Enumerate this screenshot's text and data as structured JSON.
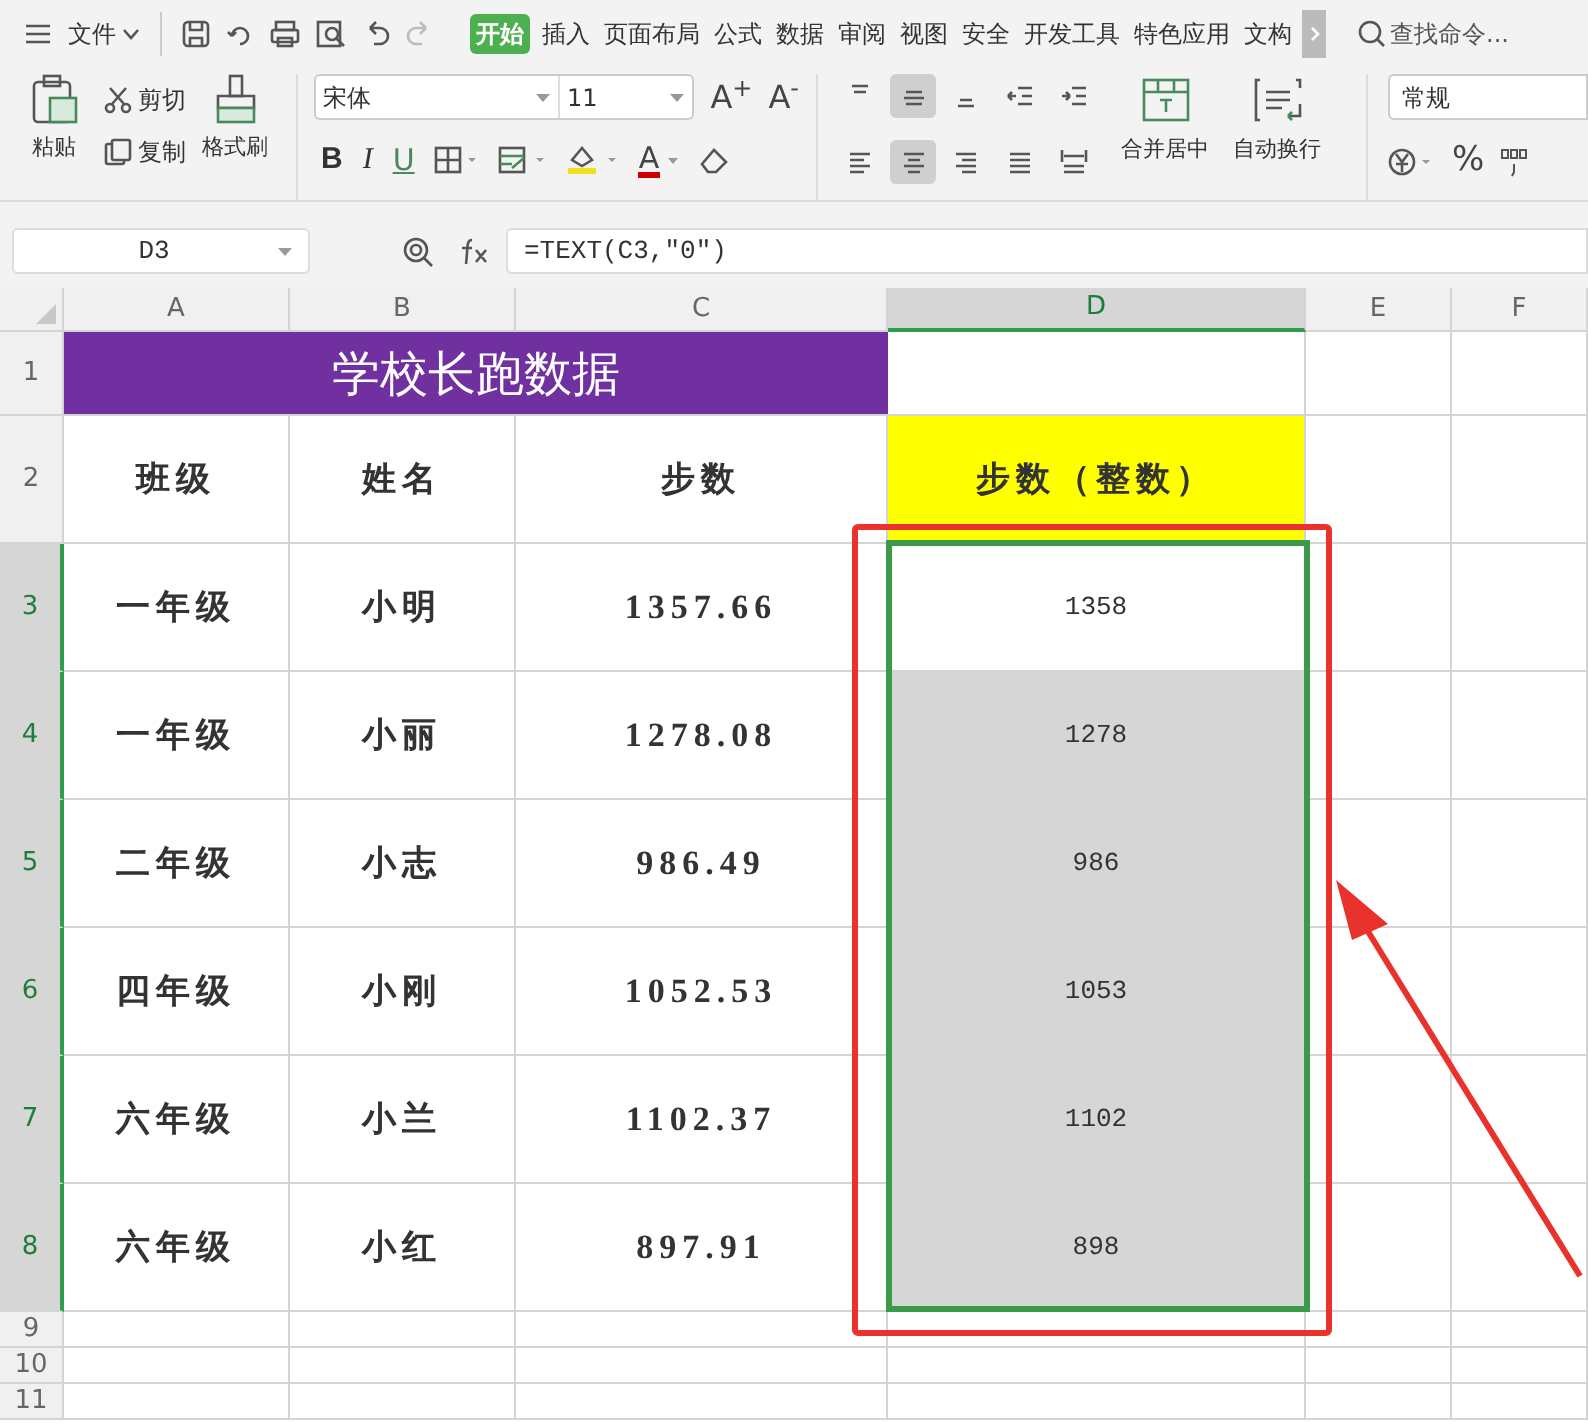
{
  "menu": {
    "file_label": "文件"
  },
  "tabs": [
    {
      "label": "开始",
      "selected": true
    },
    {
      "label": "插入",
      "selected": false
    },
    {
      "label": "页面布局",
      "selected": false
    },
    {
      "label": "公式",
      "selected": false
    },
    {
      "label": "数据",
      "selected": false
    },
    {
      "label": "审阅",
      "selected": false
    },
    {
      "label": "视图",
      "selected": false
    },
    {
      "label": "安全",
      "selected": false
    },
    {
      "label": "开发工具",
      "selected": false
    },
    {
      "label": "特色应用",
      "selected": false
    },
    {
      "label": "文构",
      "selected": false
    }
  ],
  "search": {
    "placeholder": "查找命令..."
  },
  "clipboard": {
    "paste": "粘贴",
    "cut": "剪切",
    "copy": "复制",
    "format_painter": "格式刷"
  },
  "font": {
    "name": "宋体",
    "size": "11",
    "grow": "A$^{+}$",
    "shrink": "A$^{-}$",
    "bold": "B",
    "italic": "I",
    "underline": "U",
    "font_color": "A"
  },
  "alignment": {
    "buttons": [
      {
        "kind": "top",
        "selected": false
      },
      {
        "kind": "middle",
        "selected": true
      },
      {
        "kind": "bottom",
        "selected": false
      },
      {
        "kind": "outdent",
        "selected": false
      },
      {
        "kind": "indent",
        "selected": false
      },
      {
        "kind": "left",
        "selected": false
      },
      {
        "kind": "center",
        "selected": true
      },
      {
        "kind": "right",
        "selected": false
      },
      {
        "kind": "justify",
        "selected": false
      },
      {
        "kind": "distribute",
        "selected": false
      }
    ],
    "merge": "合并居中",
    "wrap": "自动换行"
  },
  "number": {
    "format": "常规",
    "percent": "%"
  },
  "formula_bar": {
    "name_box": "D3",
    "formula": "=TEXT(C3,\"0\")"
  },
  "columns": [
    {
      "label": "A",
      "selected": false
    },
    {
      "label": "B",
      "selected": false
    },
    {
      "label": "C",
      "selected": false
    },
    {
      "label": "D",
      "selected": true
    },
    {
      "label": "E",
      "selected": false
    },
    {
      "label": "F",
      "selected": false
    }
  ],
  "rows": [
    {
      "kind": "title",
      "number": "1",
      "selected": false,
      "cells": [
        "学校长跑数据"
      ]
    },
    {
      "kind": "header",
      "number": "2",
      "selected": false,
      "cells": [
        "班级",
        "姓名",
        "步数",
        "步数（整数）"
      ]
    },
    {
      "kind": "data",
      "number": "3",
      "selected": true,
      "active": true,
      "cells": [
        "一年级",
        "小明",
        "1357.66",
        "1358"
      ]
    },
    {
      "kind": "data",
      "number": "4",
      "selected": true,
      "active": false,
      "cells": [
        "一年级",
        "小丽",
        "1278.08",
        "1278"
      ]
    },
    {
      "kind": "data",
      "number": "5",
      "selected": true,
      "active": false,
      "cells": [
        "二年级",
        "小志",
        "986.49",
        "986"
      ]
    },
    {
      "kind": "data",
      "number": "6",
      "selected": true,
      "active": false,
      "cells": [
        "四年级",
        "小刚",
        "1052.53",
        "1053"
      ]
    },
    {
      "kind": "data",
      "number": "7",
      "selected": true,
      "active": false,
      "cells": [
        "六年级",
        "小兰",
        "1102.37",
        "1102"
      ]
    },
    {
      "kind": "data",
      "number": "8",
      "selected": true,
      "active": false,
      "cells": [
        "六年级",
        "小红",
        "897.91",
        "898"
      ]
    },
    {
      "kind": "empty",
      "number": "9",
      "selected": false
    },
    {
      "kind": "empty",
      "number": "10",
      "selected": false
    },
    {
      "kind": "empty",
      "number": "11",
      "selected": false
    }
  ]
}
